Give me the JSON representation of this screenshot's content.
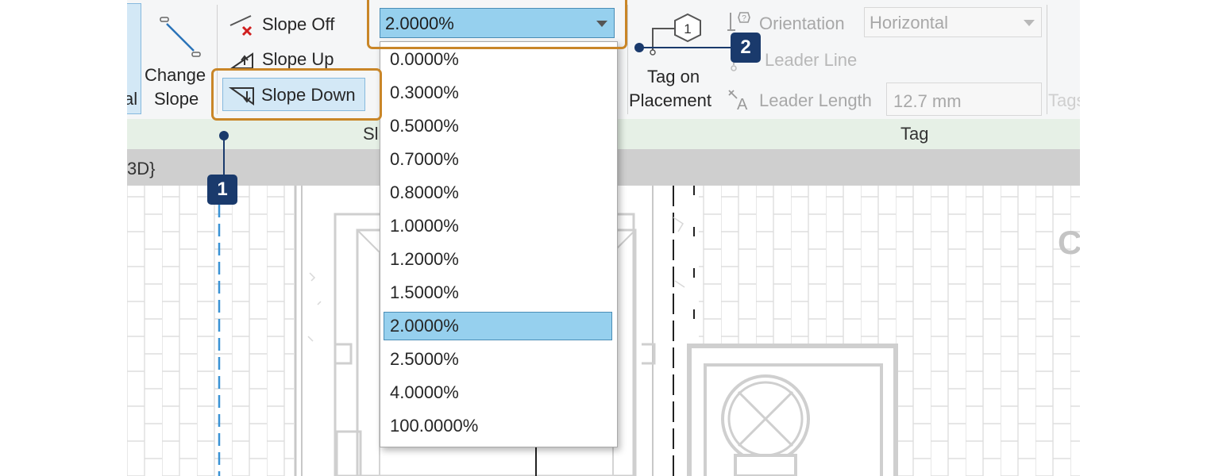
{
  "ribbon": {
    "left_cut_label": "al",
    "change_slope": {
      "line1": "Change",
      "line2": "Slope"
    },
    "slope_off": "Slope Off",
    "slope_up": "Slope Up",
    "slope_down": "Slope Down",
    "slope_panel_label": "Sl",
    "tag_on_placement": {
      "line1": "Tag on",
      "line2": "Placement"
    },
    "tag_icon_text": "1",
    "orientation_label": "Orientation",
    "orientation_value": "Horizontal",
    "leader_line": "Leader Line",
    "leader_length_label": "Leader Length",
    "leader_length_value": "12.7 mm",
    "tags_cut_label": "Tags",
    "tag_panel_label": "Tag"
  },
  "slope_combo": {
    "value": "2.0000%",
    "options": [
      "0.0000%",
      "0.3000%",
      "0.5000%",
      "0.7000%",
      "0.8000%",
      "1.0000%",
      "1.2000%",
      "1.5000%",
      "2.0000%",
      "2.5000%",
      "4.0000%",
      "100.0000%"
    ],
    "selected_index": 8
  },
  "view": {
    "tab_text": "3D}"
  },
  "canvas": {
    "right_cut_text": "C"
  },
  "callouts": [
    {
      "number": "1",
      "target": "slope-down-button"
    },
    {
      "number": "2",
      "target": "slope-value-combo"
    }
  ],
  "colors": {
    "callout_border": "#c98628",
    "badge_bg": "#1a3a6c",
    "selection_bg": "#96d0ee",
    "ribbon_label_bar": "#e6f0e6",
    "dashed_line": "#3a92d4"
  }
}
